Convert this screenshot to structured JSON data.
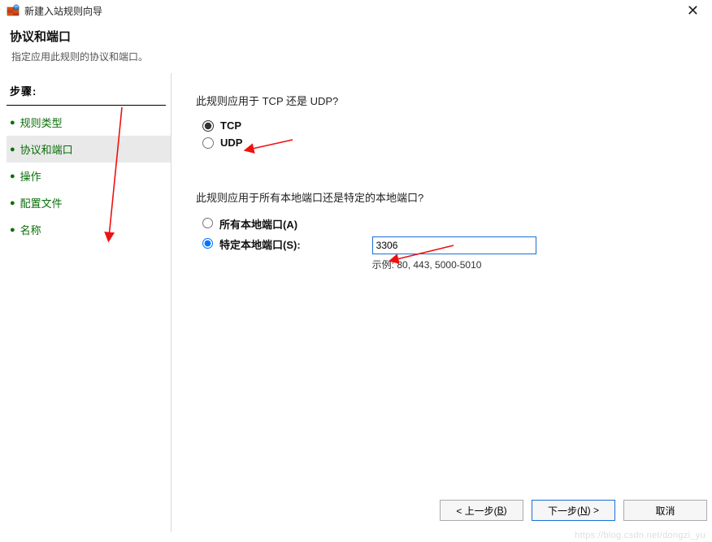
{
  "titlebar": {
    "title": "新建入站规则向导"
  },
  "header": {
    "title": "协议和端口",
    "subtitle": "指定应用此规则的协议和端口。"
  },
  "sidebar": {
    "steps_label": "步骤:",
    "items": [
      {
        "label": "规则类型"
      },
      {
        "label": "协议和端口"
      },
      {
        "label": "操作"
      },
      {
        "label": "配置文件"
      },
      {
        "label": "名称"
      }
    ]
  },
  "content": {
    "protocol_question": "此规则应用于 TCP 还是 UDP?",
    "tcp_label": "TCP",
    "udp_label": "UDP",
    "port_question": "此规则应用于所有本地端口还是特定的本地端口?",
    "all_ports_label": "所有本地端口(A)",
    "specific_ports_label": "特定本地端口(S):",
    "port_value": "3306",
    "port_example": "示例: 80, 443, 5000-5010"
  },
  "footer": {
    "back_prefix": "< 上一步(",
    "back_key": "B",
    "back_suffix": ")",
    "next_prefix": "下一步(",
    "next_key": "N",
    "next_suffix": ") >",
    "cancel": "取消"
  },
  "watermark": "https://blog.csdn.net/dongzi_yu"
}
